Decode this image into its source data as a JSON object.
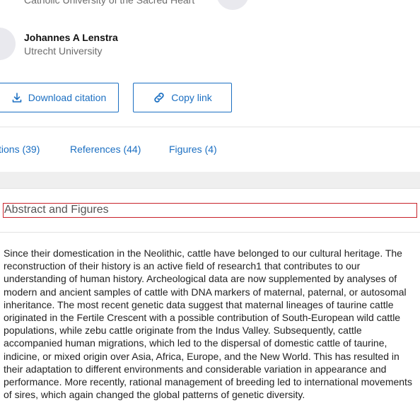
{
  "authors": [
    {
      "affiliation": "Catholic University of the Sacred Heart"
    },
    {
      "name": "Johannes A Lenstra",
      "affiliation": "Utrecht University"
    }
  ],
  "actions": {
    "download_label": "Download citation",
    "copy_label": "Copy link"
  },
  "tabs": [
    {
      "label": "tions (39)"
    },
    {
      "label": "References (44)"
    },
    {
      "label": "Figures (4)"
    }
  ],
  "section": {
    "title": "Abstract and Figures"
  },
  "abstract": {
    "text": "Since their domestication in the Neolithic, cattle have belonged to our cultural heritage. The reconstruction of their history is an active field of research1 that contributes to our understanding of human history. Archeological data are now supplemented by analyses of modern and ancient samples of cattle with DNA markers of maternal, paternal, or autosomal inheritance. The most recent genetic data suggest that maternal lineages of taurine cattle originated in the Fertile Crescent with a possible contribution of South-European wild cattle populations, while zebu cattle originate from the Indus Valley. Subsequently, cattle accompanied human migrations, which led to the dispersal of domestic cattle of taurine, indicine, or mixed origin over Asia, Africa, Europe, and the New World. This has resulted in their adaptation to different environments and considerable variation in appearance and performance. More recently, rational management of breeding led to international movements of sires, which again changed the global patterns of genetic diversity."
  },
  "icons": {
    "download": "download-icon",
    "copy": "link-icon"
  },
  "colors": {
    "link": "#1b6fc2",
    "highlight_border": "#c8222a",
    "band": "#efefef"
  }
}
